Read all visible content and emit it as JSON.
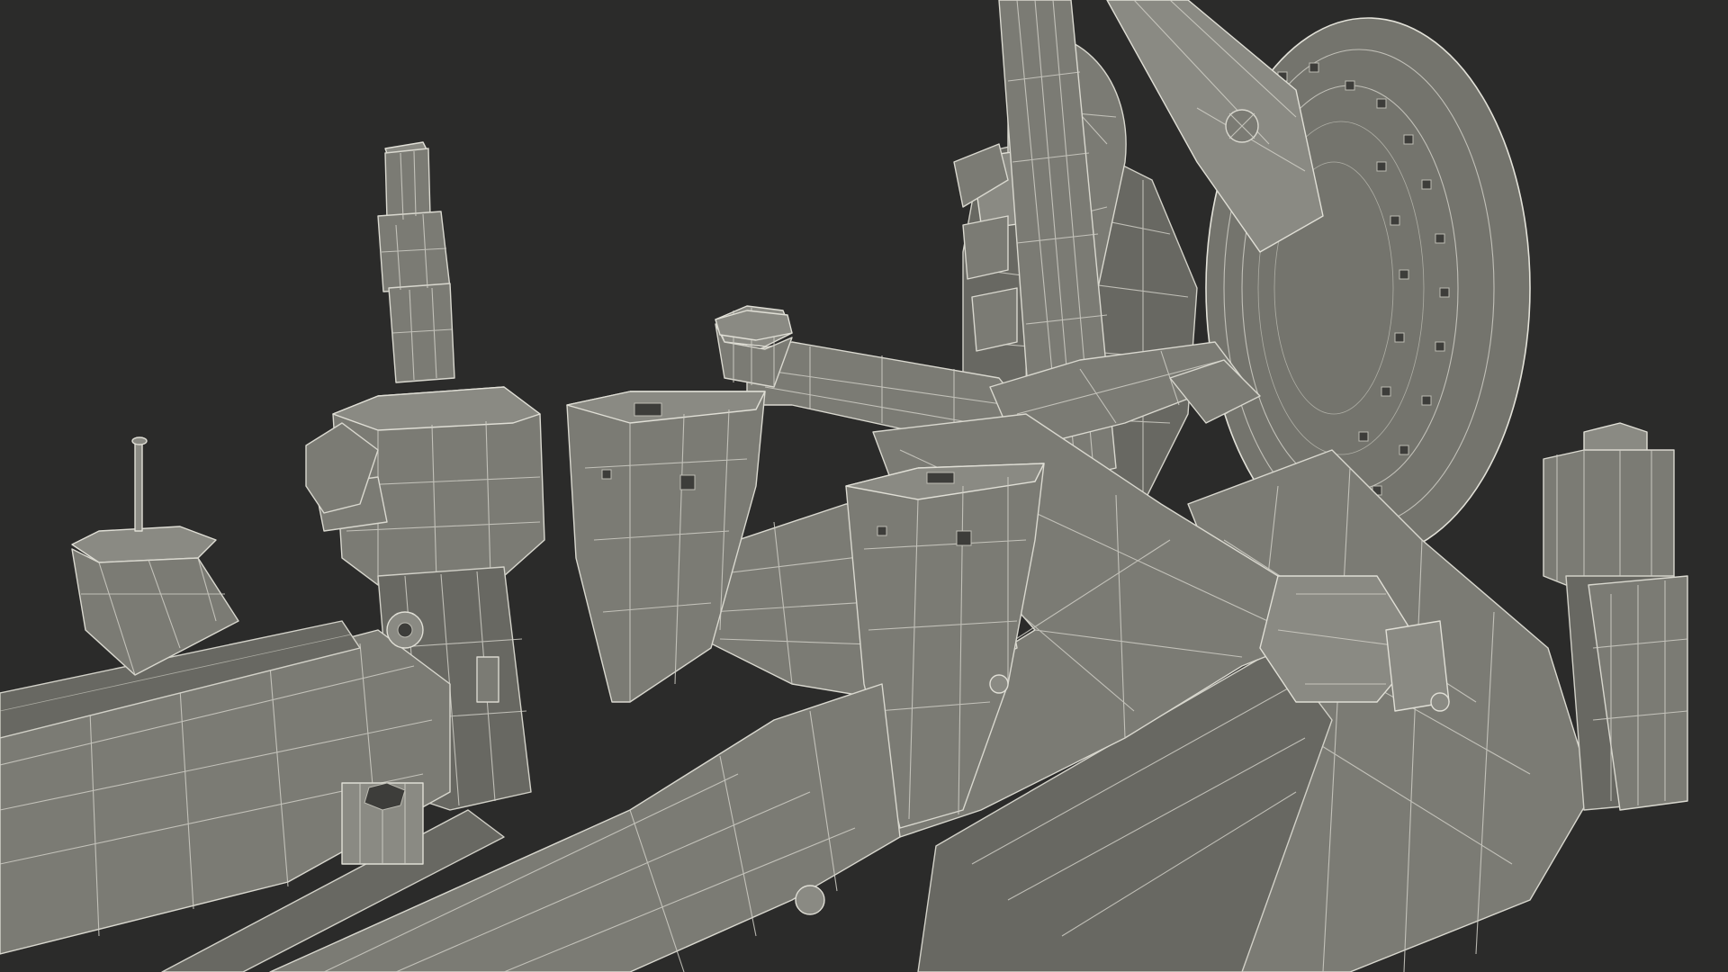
{
  "scene": {
    "background_color": "#2b2b2a",
    "mesh_fill_color": "#7b7b74",
    "wireframe_color": "#d9d8cf"
  }
}
